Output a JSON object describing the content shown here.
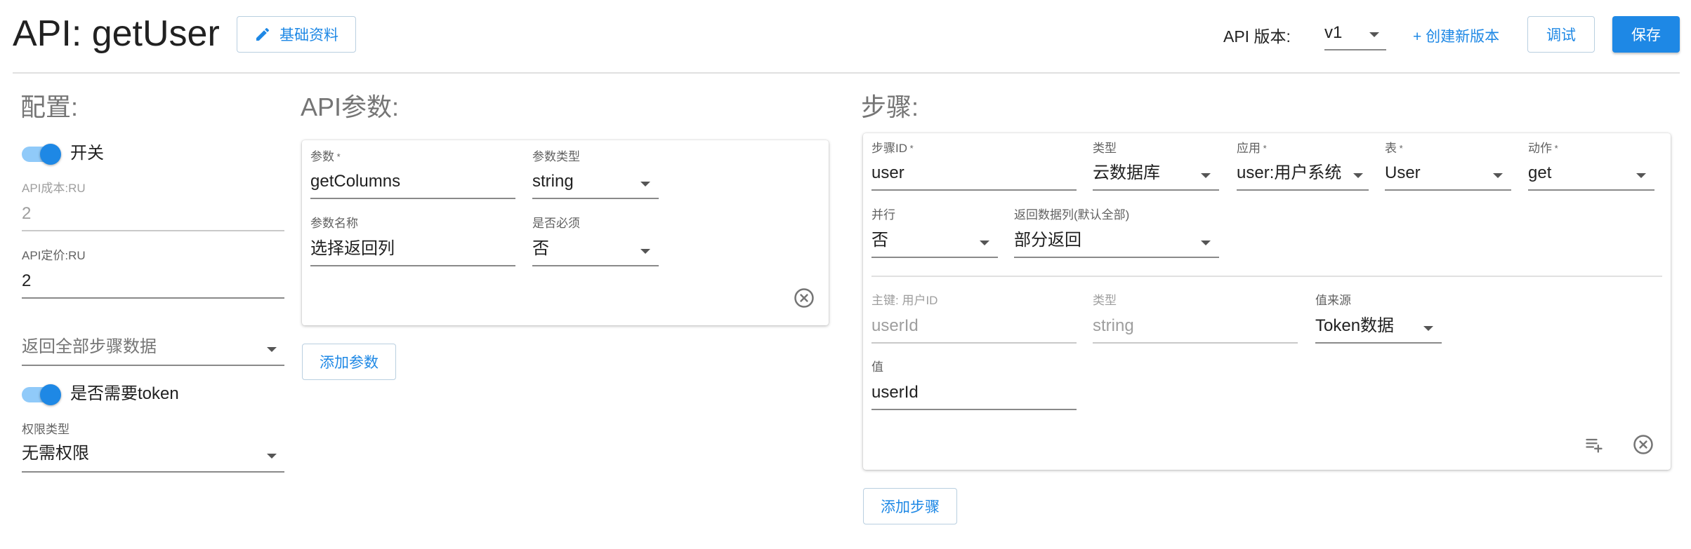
{
  "header": {
    "title": "API: getUser",
    "basic_info_label": "基础资料",
    "version_label": "API 版本:",
    "version_value": "v1",
    "create_version_label": "+ 创建新版本",
    "debug_label": "调试",
    "save_label": "保存"
  },
  "config": {
    "title": "配置:",
    "switch_label": "开关",
    "switch_on": true,
    "cost_label": "API成本:RU",
    "cost_value": "2",
    "price_label": "API定价:RU",
    "price_value": "2",
    "return_mode_value": "返回全部步骤数据",
    "token_label": "是否需要token",
    "token_on": true,
    "permission_label": "权限类型",
    "permission_value": "无需权限"
  },
  "params": {
    "title": "API参数:",
    "param_label": "参数",
    "param_value": "getColumns",
    "type_label": "参数类型",
    "type_value": "string",
    "name_label": "参数名称",
    "name_value": "选择返回列",
    "required_label": "是否必须",
    "required_value": "否",
    "add_label": "添加参数"
  },
  "steps": {
    "title": "步骤:",
    "step_id_label": "步骤ID",
    "step_id_value": "user",
    "type_label": "类型",
    "type_value": "云数据库",
    "app_label": "应用",
    "app_value": "user:用户系统",
    "table_label": "表",
    "table_value": "User",
    "action_label": "动作",
    "action_value": "get",
    "parallel_label": "并行",
    "parallel_value": "否",
    "return_cols_label": "返回数据列(默认全部)",
    "return_cols_value": "部分返回",
    "pk_label": "主键: 用户ID",
    "pk_value": "userId",
    "pk_type_label": "类型",
    "pk_type_value": "string",
    "source_label": "值来源",
    "source_value": "Token数据",
    "val_label": "值",
    "val_value": "userId",
    "add_label": "添加步骤"
  },
  "colors": {
    "accent": "#1e88e5",
    "accent_light": "#90caf9"
  },
  "icons": [
    "pencil-icon",
    "chevron-down-icon",
    "close-circle-icon",
    "playlist-add-icon"
  ]
}
